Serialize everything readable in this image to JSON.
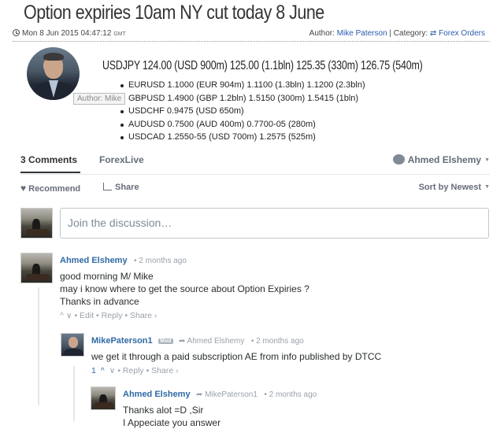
{
  "article": {
    "title": "Option expiries 10am NY cut today 8 June",
    "date": "Mon 8 Jun 2015 04:47:12",
    "timezone": "GMT",
    "author_prefix": "Author:",
    "author": "Mike Paterson",
    "category_prefix": "| Category:",
    "category_icon": "⇄",
    "category": "Forex Orders",
    "tooltip": "Author: Mike",
    "usdjpy": "USDJPY  124.00 (USD 900m) 125.00 (1.1bln) 125.35 (330m) 126.75 (540m)",
    "options": [
      "EURUSD 1.1000 (EUR 904m) 1.1100 (1.3bln) 1.1200 (2.3bln)",
      "GBPUSD 1.4900 (GBP 1.2bln)  1.5150 (300m) 1.5415 (1bln)",
      "USDCHF 0.9475 (USD 650m)",
      "AUDUSD 0.7500 (AUD 400m) 0.7700-05 (280m)",
      "USDCAD 1.2550-55 (USD 700m) 1.2575 (525m)"
    ]
  },
  "discussion": {
    "tab_comments": "3 Comments",
    "tab_forexlive": "ForexLive",
    "user": "Ahmed Elshemy",
    "recommend": "Recommend",
    "share": "Share",
    "sort": "Sort by Newest",
    "input_placeholder": "Join the discussion…"
  },
  "comments": [
    {
      "author": "Ahmed Elshemy",
      "time": "2 months ago",
      "lines": [
        "good morning M/ Mike",
        "may i know where to get the source about Option Expiries ?",
        "Thanks in advance"
      ],
      "footer": "^ ∨ • Edit • Reply • Share ›"
    },
    {
      "author": "MikePaterson1",
      "badge": "Mod",
      "reply_to": "➦ Ahmed Elshemy",
      "time": "2 months ago",
      "lines": [
        "we get it through a paid subscription AE from info published by DTCC"
      ],
      "votes": "1",
      "footer": "∨ • Reply • Share ›"
    },
    {
      "author": "Ahmed Elshemy",
      "reply_to": "➦ MikePaterson1",
      "time": "2 months ago",
      "lines": [
        "Thanks alot =D ,Sir",
        "I Appeciate you answer"
      ]
    }
  ],
  "colors": {
    "link": "#2f6aa6",
    "muted": "#9aa2ab",
    "text": "#2a2e2e"
  }
}
